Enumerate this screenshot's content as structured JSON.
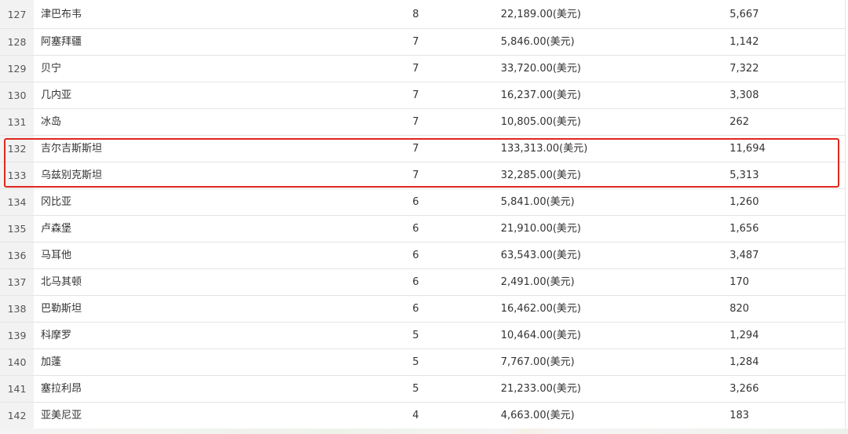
{
  "rows": [
    {
      "rank": "127",
      "country": "津巴布韦",
      "count": "8",
      "gdp": "22,189.00(美元)",
      "population": "5,667"
    },
    {
      "rank": "128",
      "country": "阿塞拜疆",
      "count": "7",
      "gdp": "5,846.00(美元)",
      "population": "1,142"
    },
    {
      "rank": "129",
      "country": "贝宁",
      "count": "7",
      "gdp": "33,720.00(美元)",
      "population": "7,322"
    },
    {
      "rank": "130",
      "country": "几内亚",
      "count": "7",
      "gdp": "16,237.00(美元)",
      "population": "3,308"
    },
    {
      "rank": "131",
      "country": "冰岛",
      "count": "7",
      "gdp": "10,805.00(美元)",
      "population": "262"
    },
    {
      "rank": "132",
      "country": "吉尔吉斯斯坦",
      "count": "7",
      "gdp": "133,313.00(美元)",
      "population": "11,694"
    },
    {
      "rank": "133",
      "country": "乌兹别克斯坦",
      "count": "7",
      "gdp": "32,285.00(美元)",
      "population": "5,313"
    },
    {
      "rank": "134",
      "country": "冈比亚",
      "count": "6",
      "gdp": "5,841.00(美元)",
      "population": "1,260"
    },
    {
      "rank": "135",
      "country": "卢森堡",
      "count": "6",
      "gdp": "21,910.00(美元)",
      "population": "1,656"
    },
    {
      "rank": "136",
      "country": "马耳他",
      "count": "6",
      "gdp": "63,543.00(美元)",
      "population": "3,487"
    },
    {
      "rank": "137",
      "country": "北马其顿",
      "count": "6",
      "gdp": "2,491.00(美元)",
      "population": "170"
    },
    {
      "rank": "138",
      "country": "巴勒斯坦",
      "count": "6",
      "gdp": "16,462.00(美元)",
      "population": "820"
    },
    {
      "rank": "139",
      "country": "科摩罗",
      "count": "5",
      "gdp": "10,464.00(美元)",
      "population": "1,294"
    },
    {
      "rank": "140",
      "country": "加蓬",
      "count": "5",
      "gdp": "7,767.00(美元)",
      "population": "1,284"
    },
    {
      "rank": "141",
      "country": "塞拉利昂",
      "count": "5",
      "gdp": "21,233.00(美元)",
      "population": "3,266"
    },
    {
      "rank": "142",
      "country": "亚美尼亚",
      "count": "4",
      "gdp": "4,663.00(美元)",
      "population": "183"
    }
  ],
  "highlight": {
    "color": "#e0281e",
    "rows": [
      "132",
      "133"
    ]
  }
}
